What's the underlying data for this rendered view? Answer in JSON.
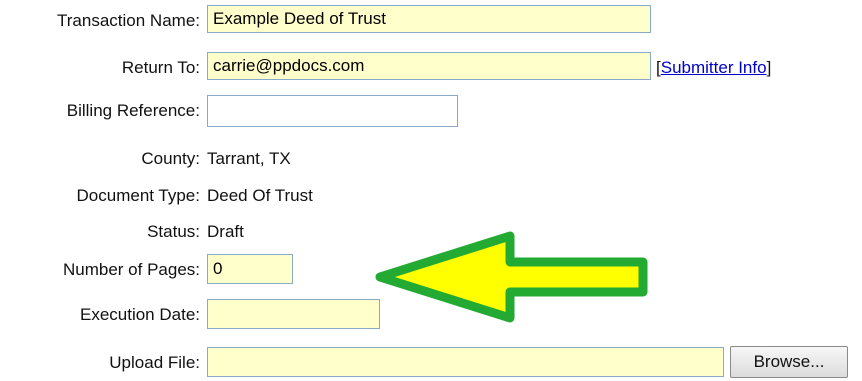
{
  "form": {
    "transaction_name": {
      "label": "Transaction Name:",
      "value": "Example Deed of Trust"
    },
    "return_to": {
      "label": "Return To:",
      "value": "carrie@ppdocs.com",
      "link_open": "[",
      "link_text": "Submitter Info",
      "link_close": "]"
    },
    "billing_reference": {
      "label": "Billing Reference:",
      "value": ""
    },
    "county": {
      "label": "County:",
      "value": "Tarrant, TX"
    },
    "document_type": {
      "label": "Document Type:",
      "value": "Deed Of Trust"
    },
    "status": {
      "label": "Status:",
      "value": "Draft"
    },
    "number_of_pages": {
      "label": "Number of Pages:",
      "value": "0"
    },
    "execution_date": {
      "label": "Execution Date:",
      "value": ""
    },
    "upload_file": {
      "label": "Upload File:",
      "value": "",
      "browse_label": "Browse..."
    }
  },
  "colors": {
    "field_fill": "#ffffcc",
    "field_border": "#8aa8c8",
    "link": "#0000cc",
    "arrow_fill": "#ffff00",
    "arrow_stroke": "#22aa33"
  },
  "icons": {
    "annotation": "left-arrow-icon"
  }
}
